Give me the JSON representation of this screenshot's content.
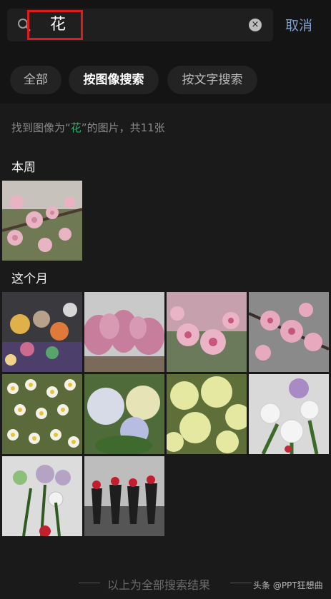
{
  "search": {
    "query": "花",
    "cancel_label": "取消",
    "clear_icon": "clear-icon"
  },
  "filters": [
    {
      "label": "全部",
      "active": false
    },
    {
      "label": "按图像搜索",
      "active": true
    },
    {
      "label": "按文字搜索",
      "active": false
    }
  ],
  "result": {
    "prefix": "找到图像为“",
    "keyword": "花",
    "suffix": "”的图片，共11张"
  },
  "sections": {
    "this_week": "本周",
    "this_month": "这个月"
  },
  "footer": {
    "text": "以上为全部搜索结果",
    "watermark": "头条 @PPT狂想曲"
  },
  "colors": {
    "accent_link": "#7f9ecb",
    "keyword_green": "#2fb56a",
    "annotation_red": "#e01b1b"
  },
  "photos": [
    {
      "subject": "pink-blossom-branch"
    },
    {
      "subject": "toy-figures"
    },
    {
      "subject": "pink-blossom-trees"
    },
    {
      "subject": "pink-blossom-closeup"
    },
    {
      "subject": "pink-blossom-closeup-2"
    },
    {
      "subject": "white-daisies"
    },
    {
      "subject": "hydrangea"
    },
    {
      "subject": "yellow-chrysanthemum"
    },
    {
      "subject": "white-chrysanthemum"
    },
    {
      "subject": "bouquet-chrysanthemum"
    },
    {
      "subject": "red-rose-bouquets"
    }
  ]
}
